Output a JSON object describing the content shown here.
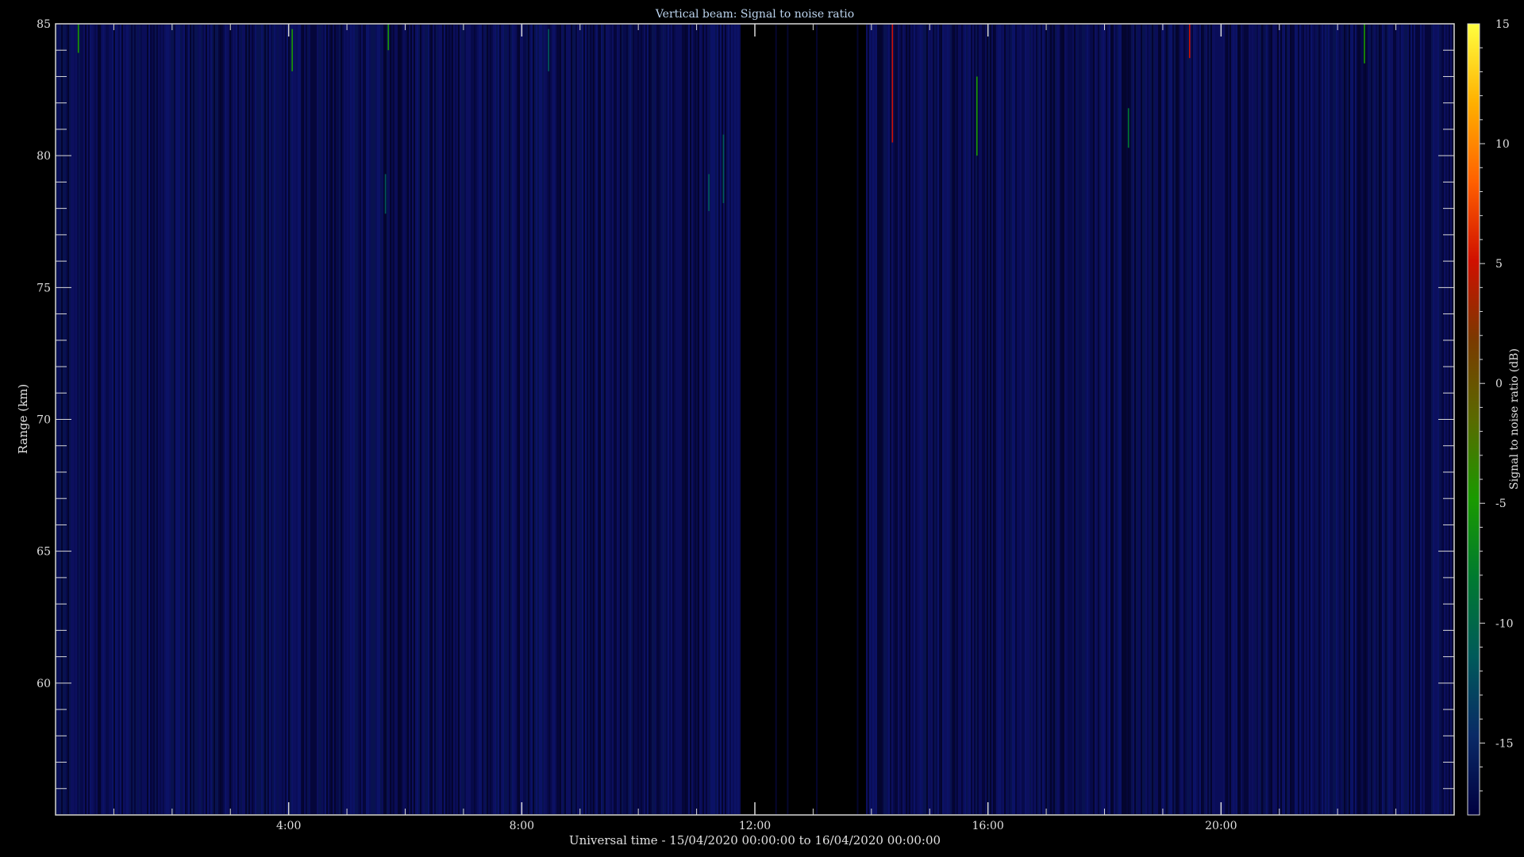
{
  "chart_data": {
    "type": "heatmap",
    "title": "Vertical beam: Signal to noise ratio",
    "xlabel": "Universal time - 15/04/2020 00:00:00 to 16/04/2020 00:00:00",
    "ylabel": "Range (km)",
    "colorbar_label": "Signal to noise ratio (dB)",
    "x_range_hours": [
      0,
      24
    ],
    "x_ticks": [
      {
        "value": 4,
        "label": "4:00"
      },
      {
        "value": 8,
        "label": "8:00"
      },
      {
        "value": 12,
        "label": "12:00"
      },
      {
        "value": 16,
        "label": "16:00"
      },
      {
        "value": 20,
        "label": "20:00"
      }
    ],
    "y_range_km": [
      55,
      85
    ],
    "y_ticks": [
      {
        "value": 60,
        "label": "60"
      },
      {
        "value": 65,
        "label": "65"
      },
      {
        "value": 70,
        "label": "70"
      },
      {
        "value": 75,
        "label": "75"
      },
      {
        "value": 80,
        "label": "80"
      },
      {
        "value": 85,
        "label": "85"
      }
    ],
    "colorbar_range_db": [
      -18,
      15
    ],
    "colorbar_ticks": [
      {
        "value": 15,
        "label": "15"
      },
      {
        "value": 10,
        "label": "10"
      },
      {
        "value": 5,
        "label": "5"
      },
      {
        "value": 0,
        "label": "0"
      },
      {
        "value": -5,
        "label": "-5"
      },
      {
        "value": -10,
        "label": "-10"
      },
      {
        "value": -15,
        "label": "-15"
      }
    ],
    "colormap": [
      "#000040",
      "#0a2a66",
      "#005a5a",
      "#007a30",
      "#1a9a00",
      "#5a6a00",
      "#7a3a00",
      "#d01000",
      "#ff6000",
      "#ffb000",
      "#ffff40"
    ],
    "background_level_db": -17,
    "data_gaps_hours": [
      [
        11.75,
        13.9
      ]
    ],
    "streaks": [
      {
        "t": 0.38,
        "r": [
          83.9,
          85.0
        ],
        "snr": -6
      },
      {
        "t": 4.05,
        "r": [
          83.2,
          84.8
        ],
        "snr": -6
      },
      {
        "t": 5.7,
        "r": [
          84.0,
          85.0
        ],
        "snr": -6
      },
      {
        "t": 5.65,
        "r": [
          77.8,
          79.3
        ],
        "snr": -10
      },
      {
        "t": 8.45,
        "r": [
          83.2,
          84.8
        ],
        "snr": -11
      },
      {
        "t": 11.2,
        "r": [
          77.9,
          79.3
        ],
        "snr": -11
      },
      {
        "t": 11.45,
        "r": [
          78.2,
          80.8
        ],
        "snr": -12
      },
      {
        "t": 14.35,
        "r": [
          80.5,
          85.0
        ],
        "snr": 4
      },
      {
        "t": 15.8,
        "r": [
          80.0,
          83.0
        ],
        "snr": -6
      },
      {
        "t": 18.4,
        "r": [
          80.3,
          81.8
        ],
        "snr": -7
      },
      {
        "t": 19.45,
        "r": [
          83.7,
          85.0
        ],
        "snr": 5
      },
      {
        "t": 22.45,
        "r": [
          83.5,
          85.0
        ],
        "snr": -5
      }
    ]
  }
}
